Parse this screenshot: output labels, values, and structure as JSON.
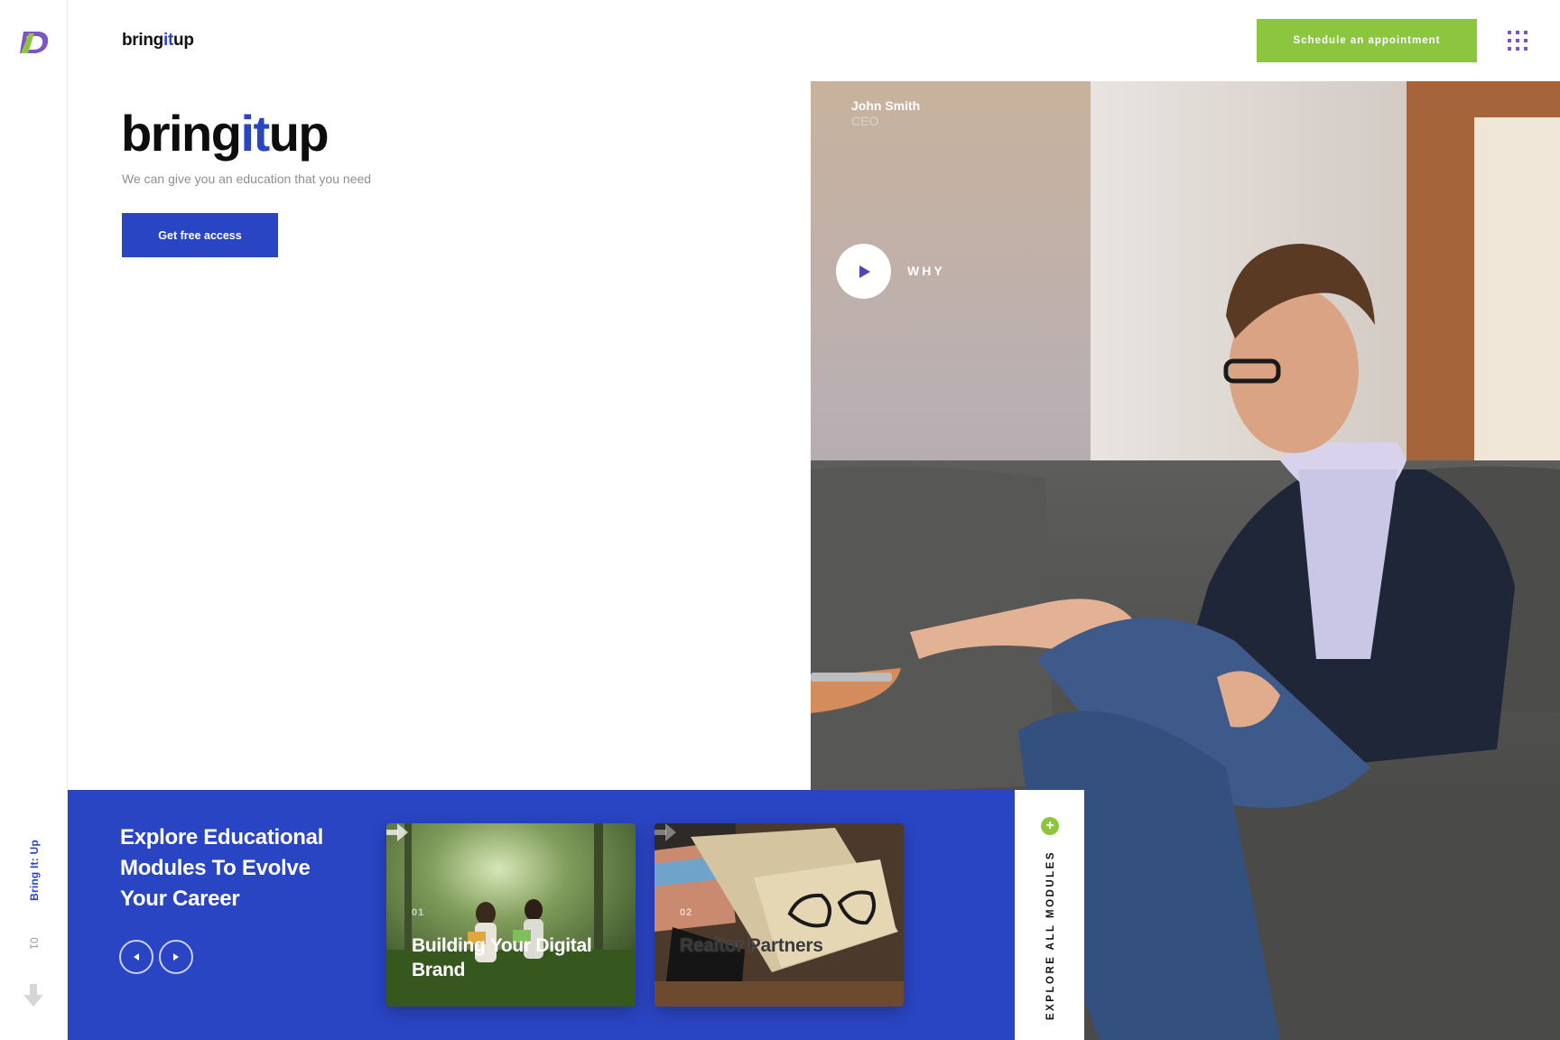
{
  "sidebar": {
    "vertical_title": "Bring It: Up",
    "slide_number": "01"
  },
  "header": {
    "brand": {
      "part1": "bring",
      "part2": "it",
      "part3": "up"
    },
    "schedule_label": "Schedule an appointment"
  },
  "hero": {
    "title": {
      "part1": "bring",
      "part2": "it",
      "part3": "up"
    },
    "subtitle": "We can give you an education that you need",
    "cta_label": "Get free access"
  },
  "video": {
    "person_name": "John Smith",
    "person_role": "CEO",
    "play_label": "WHY"
  },
  "modules": {
    "title": "Explore Educational Modules To Evolve Your Career",
    "cards": [
      {
        "number": "01",
        "title": "Building Your Digital Brand"
      },
      {
        "number": "02",
        "title": "Realtor Partners"
      }
    ],
    "explore_label": "EXPLORE ALL MODULES"
  },
  "colors": {
    "accent_blue": "#2a45c4",
    "accent_green": "#8cc63f",
    "accent_purple": "#7d53c6"
  }
}
